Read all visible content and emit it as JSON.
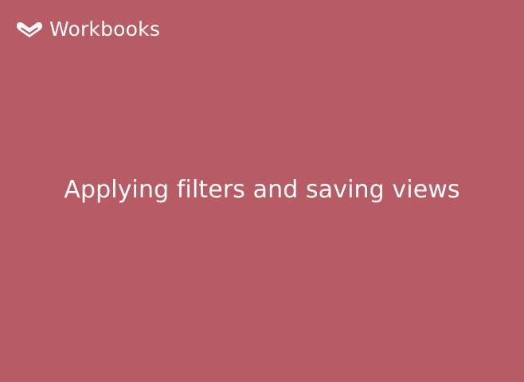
{
  "theme": {
    "background": "#b75b65",
    "foreground": "#ffffff"
  },
  "brand": {
    "icon": "workbooks-logo-icon",
    "name": "Workbooks"
  },
  "slide": {
    "title": "Applying filters and saving views"
  }
}
